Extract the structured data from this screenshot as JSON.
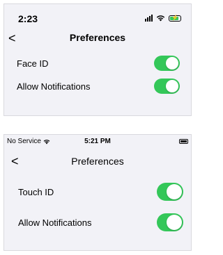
{
  "screen_top": {
    "status": {
      "time": "2:23"
    },
    "nav": {
      "back_label": "<",
      "title": "Preferences"
    },
    "settings": [
      {
        "label": "Face ID",
        "on": true
      },
      {
        "label": "Allow Notifications",
        "on": true
      }
    ]
  },
  "screen_bottom": {
    "status": {
      "carrier": "No Service",
      "time": "5:21 PM"
    },
    "nav": {
      "back_label": "<",
      "title": "Preferences"
    },
    "settings": [
      {
        "label": "Touch ID",
        "on": true
      },
      {
        "label": "Allow Notifications",
        "on": true
      }
    ]
  },
  "colors": {
    "toggle_on": "#34c759",
    "panel_bg": "#f2f2f7"
  }
}
